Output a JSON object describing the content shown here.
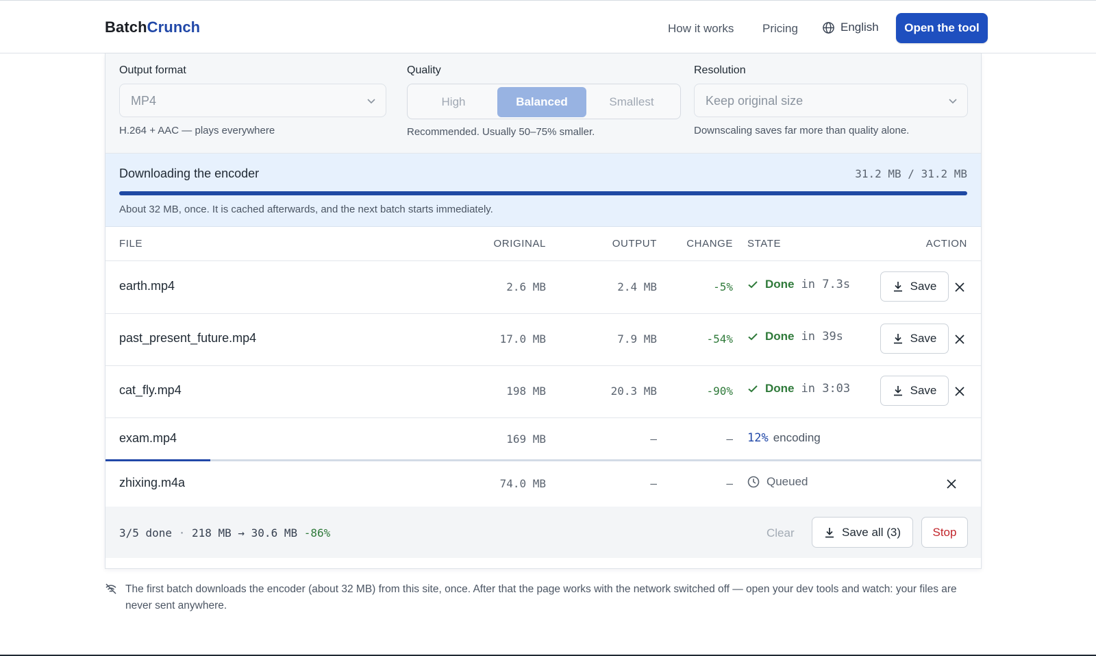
{
  "header": {
    "brand_part1": "Batch",
    "brand_part2": "Crunch",
    "nav": [
      "How it works",
      "Pricing"
    ],
    "language": "English",
    "cta": "Open the tool",
    "accent": "#1e4fbf"
  },
  "settings": {
    "format": {
      "label": "Output format",
      "value": "MP4",
      "hint": "H.264 + AAC — plays everywhere"
    },
    "quality": {
      "label": "Quality",
      "options": [
        "High",
        "Balanced",
        "Smallest"
      ],
      "selected": "Balanced",
      "hint": "Recommended. Usually 50–75% smaller."
    },
    "resolution": {
      "label": "Resolution",
      "value": "Keep original size",
      "hint": "Downscaling saves far more than quality alone."
    }
  },
  "download": {
    "title": "Downloading the encoder",
    "size": "31.2 MB / 31.2 MB",
    "progress_fraction": 1.0,
    "note": "About 32 MB, once. It is cached afterwards, and the next batch starts immediately."
  },
  "table": {
    "headers": {
      "file": "FILE",
      "original": "ORIGINAL",
      "output": "OUTPUT",
      "change": "CHANGE",
      "state": "STATE",
      "action": "ACTION"
    },
    "rows": [
      {
        "file": "earth.mp4",
        "original": "2.6 MB",
        "output": "2.4 MB",
        "change": "-5%",
        "state_label": "Done",
        "state_detail": "in 7.3s",
        "action": "Save"
      },
      {
        "file": "past_present_future.mp4",
        "original": "17.0 MB",
        "output": "7.9 MB",
        "change": "-54%",
        "state_label": "Done",
        "state_detail": "in 39s",
        "action": "Save"
      },
      {
        "file": "cat_fly.mp4",
        "original": "198 MB",
        "output": "20.3 MB",
        "change": "-90%",
        "state_label": "Done",
        "state_detail": "in 3:03",
        "action": "Save"
      },
      {
        "file": "exam.mp4",
        "original": "169 MB",
        "output": "–",
        "change": "–",
        "state_pct": "12%",
        "state_detail": "encoding",
        "progress_fraction": 0.12
      },
      {
        "file": "zhixing.m4a",
        "original": "74.0 MB",
        "output": "–",
        "change": "–",
        "state_label": "Queued"
      }
    ]
  },
  "footer": {
    "summary_done": "3/5 done",
    "summary_sizes": "218 MB → 30.6 MB",
    "summary_change": "-86%",
    "clear": "Clear",
    "save_all": "Save all (3)",
    "stop": "Stop"
  },
  "offline_note": "The first batch downloads the encoder (about 32 MB) from this site, once. After that the page works with the network switched off — open your dev tools and watch: your files are never sent anywhere.",
  "icons": {
    "globe": "globe-icon",
    "chevron": "chevron-down-icon",
    "check": "check-icon",
    "download": "download-icon",
    "close": "close-icon",
    "clock": "clock-icon",
    "wifi_off": "wifi-off-icon"
  },
  "colors": {
    "success": "#2f7a3a",
    "danger": "#c2262c",
    "progress": "#1f49a3"
  }
}
